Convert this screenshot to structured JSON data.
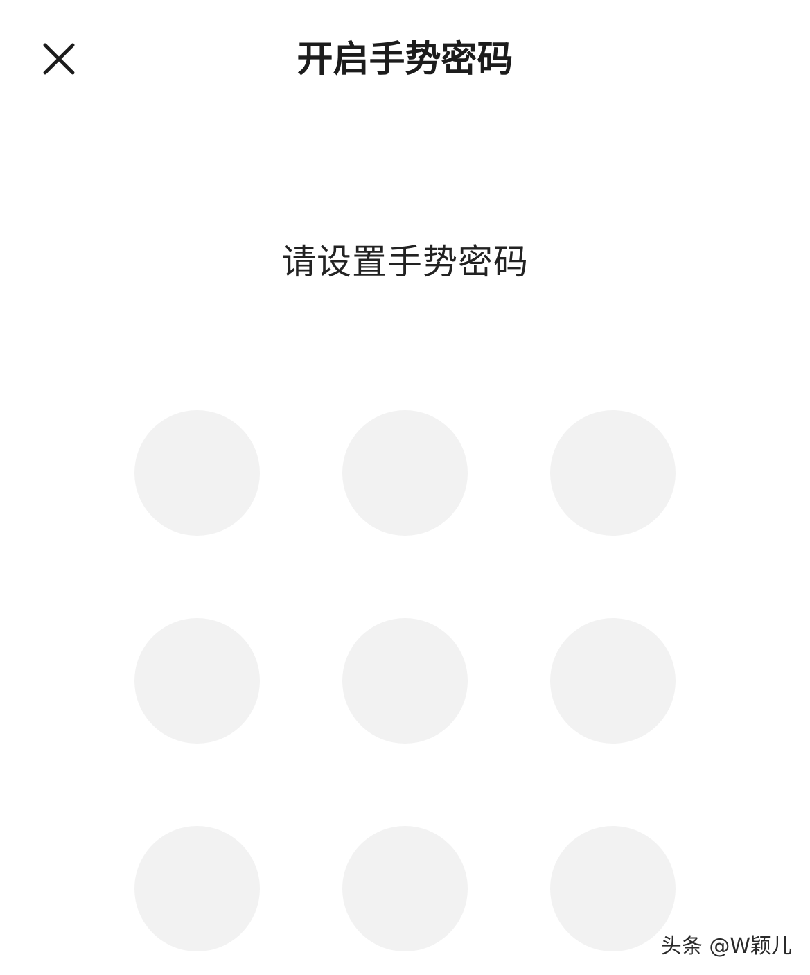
{
  "header": {
    "title": "开启手势密码",
    "close_icon": "close-icon"
  },
  "main": {
    "prompt": "请设置手势密码",
    "pattern_grid": {
      "rows": 3,
      "cols": 3,
      "dot_color": "#f2f2f2"
    }
  },
  "watermark": {
    "text": "头条 @W颖儿"
  }
}
